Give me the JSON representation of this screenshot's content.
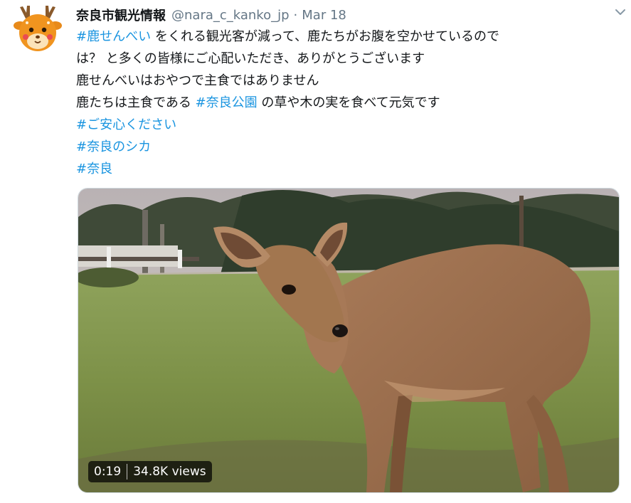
{
  "tweet": {
    "display_name": "奈良市観光情報",
    "handle": "@nara_c_kanko_jp",
    "separator": "·",
    "date": "Mar 18",
    "avatar_icon": "deer-mascot-avatar-icon",
    "menu_icon": "chevron-down-icon",
    "lines": [
      [
        {
          "text": "#鹿せんべい",
          "hashtag": true
        },
        {
          "text": " をくれる観光客が減って、鹿たちがお腹を空かせているので",
          "hashtag": false
        }
      ],
      [
        {
          "text": "は？ と多くの皆様にご心配いただき、ありがとうございます",
          "hashtag": false
        }
      ],
      [
        {
          "text": "鹿せんべいはおやつで主食ではありません",
          "hashtag": false
        }
      ],
      [
        {
          "text": "鹿たちは主食である ",
          "hashtag": false
        },
        {
          "text": "#奈良公園",
          "hashtag": true
        },
        {
          "text": " の草や木の実を食べて元気です",
          "hashtag": false
        }
      ],
      [
        {
          "text": "#ご安心ください",
          "hashtag": true
        }
      ],
      [
        {
          "text": "#奈良のシカ",
          "hashtag": true
        }
      ],
      [
        {
          "text": "#奈良",
          "hashtag": true
        }
      ]
    ]
  },
  "media": {
    "kind": "video",
    "duration": "0:19",
    "views": "34.8K views"
  },
  "colors": {
    "hashtag": "#1b95e0",
    "secondary_text": "#657786",
    "primary_text": "#14171a"
  }
}
